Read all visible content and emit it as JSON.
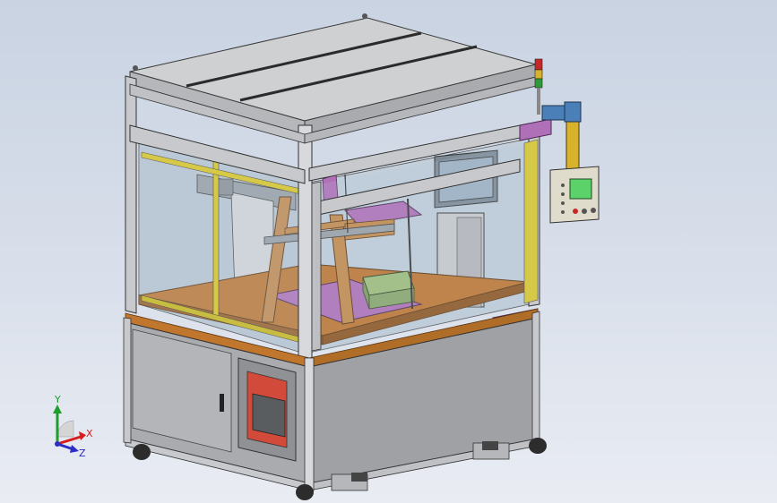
{
  "viewport": {
    "background_top": "#c9d3e2",
    "background_bottom": "#e9ecf3"
  },
  "triad": {
    "x_label": "X",
    "y_label": "Y",
    "z_label": "Z",
    "x_color": "#d81c1c",
    "y_color": "#1e9c2e",
    "z_color": "#2a2ec4"
  },
  "model": {
    "frame_color": "#c7c9cc",
    "panel_color": "#a9abae",
    "glass_color": "#b7c6d6",
    "deck_color": "#c0762c",
    "fixture_color": "#b070b8",
    "hmi_screen_color": "#5cd36a"
  }
}
